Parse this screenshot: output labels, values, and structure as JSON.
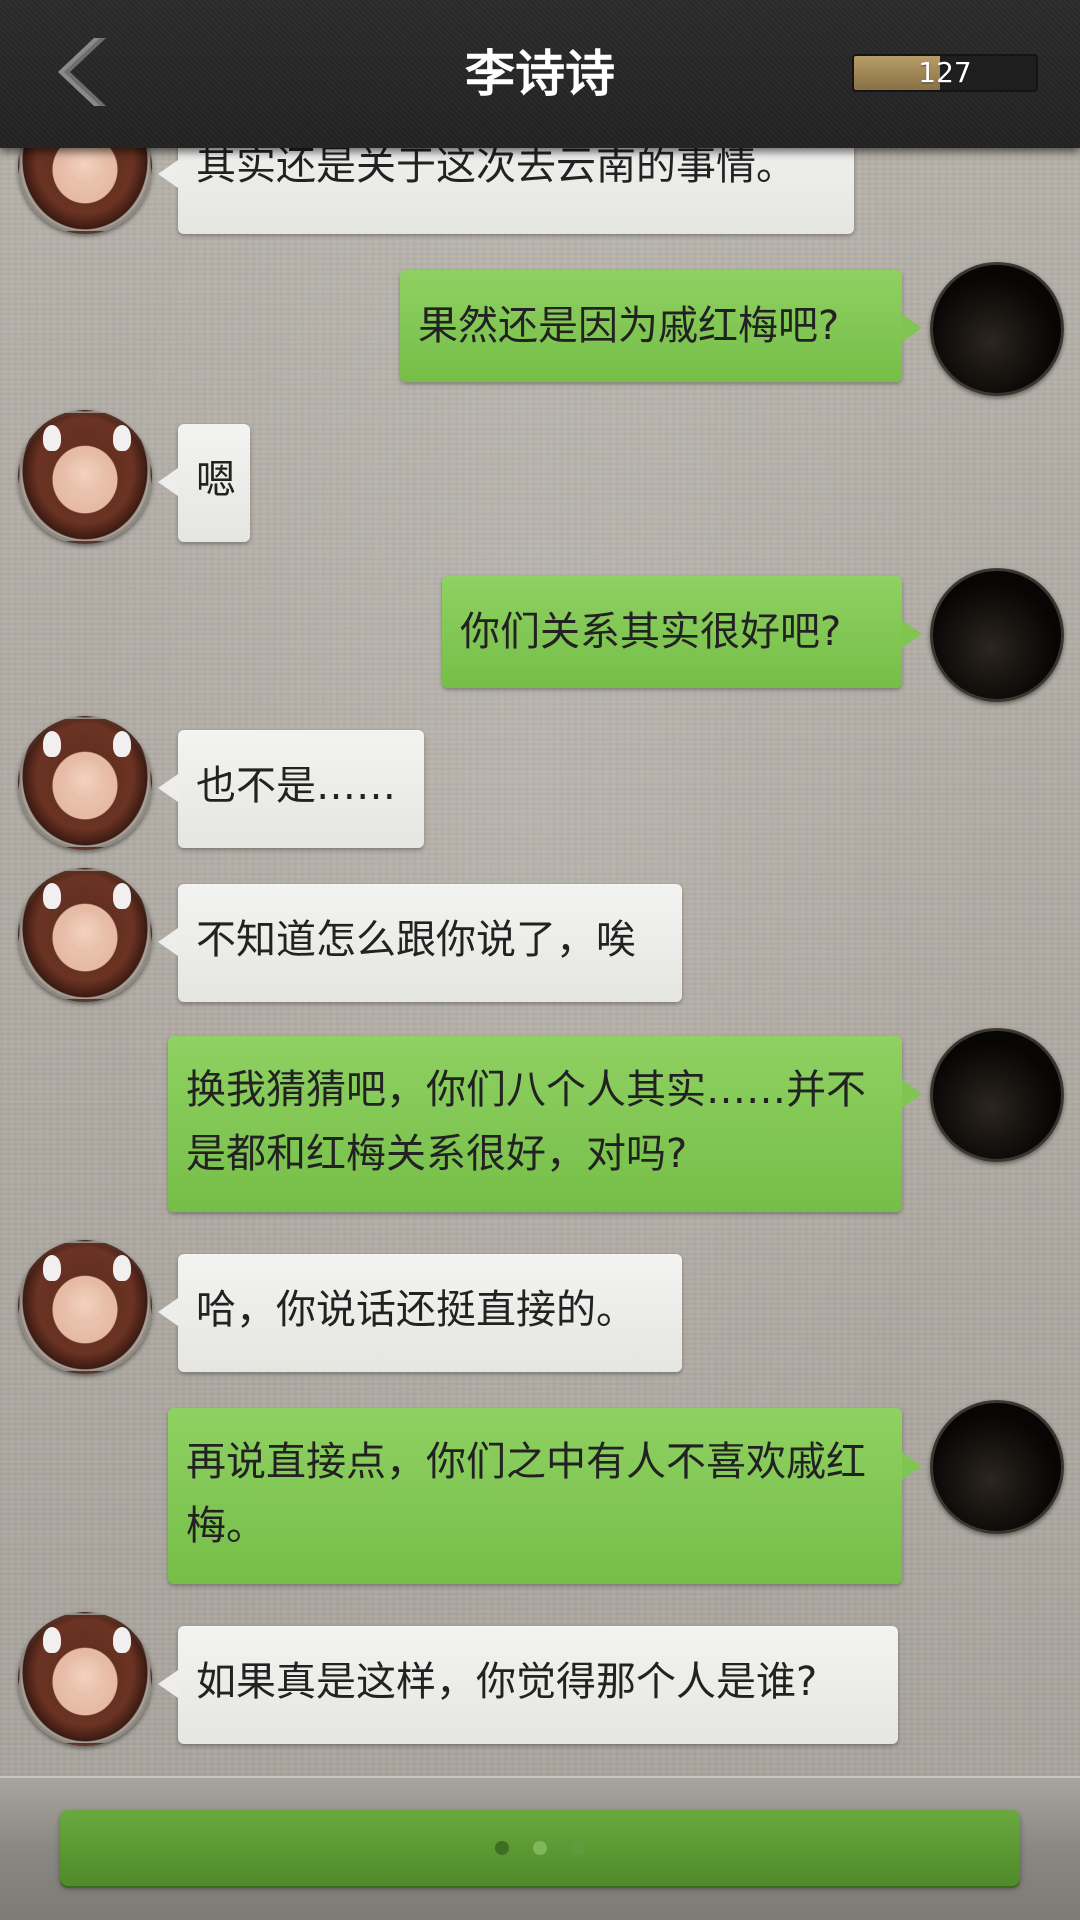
{
  "header": {
    "title": "李诗诗",
    "counter_value": "127",
    "counter_fill_fraction": 0.47
  },
  "colors": {
    "incoming_bubble": "#ececea",
    "outgoing_bubble": "#80c552",
    "header_bg": "#262626",
    "continue_button": "#5a9a33"
  },
  "messages": [
    {
      "sender": "contact",
      "text": "其实还是关于这次去云南的事情。"
    },
    {
      "sender": "me",
      "text": "果然还是因为戚红梅吧?"
    },
    {
      "sender": "contact",
      "text": "嗯"
    },
    {
      "sender": "me",
      "text": "你们关系其实很好吧?"
    },
    {
      "sender": "contact",
      "text": "也不是……"
    },
    {
      "sender": "contact",
      "text": "不知道怎么跟你说了，唉"
    },
    {
      "sender": "me",
      "text": "换我猜猜吧，你们八个人其实……并不是都和红梅关系很好，对吗?"
    },
    {
      "sender": "contact",
      "text": "哈，你说话还挺直接的。"
    },
    {
      "sender": "me",
      "text": "再说直接点，你们之中有人不喜欢戚红梅。"
    },
    {
      "sender": "contact",
      "text": "如果真是这样，你觉得那个人是谁?"
    }
  ],
  "bottom_bar": {
    "icon": "typing-dots-icon"
  }
}
